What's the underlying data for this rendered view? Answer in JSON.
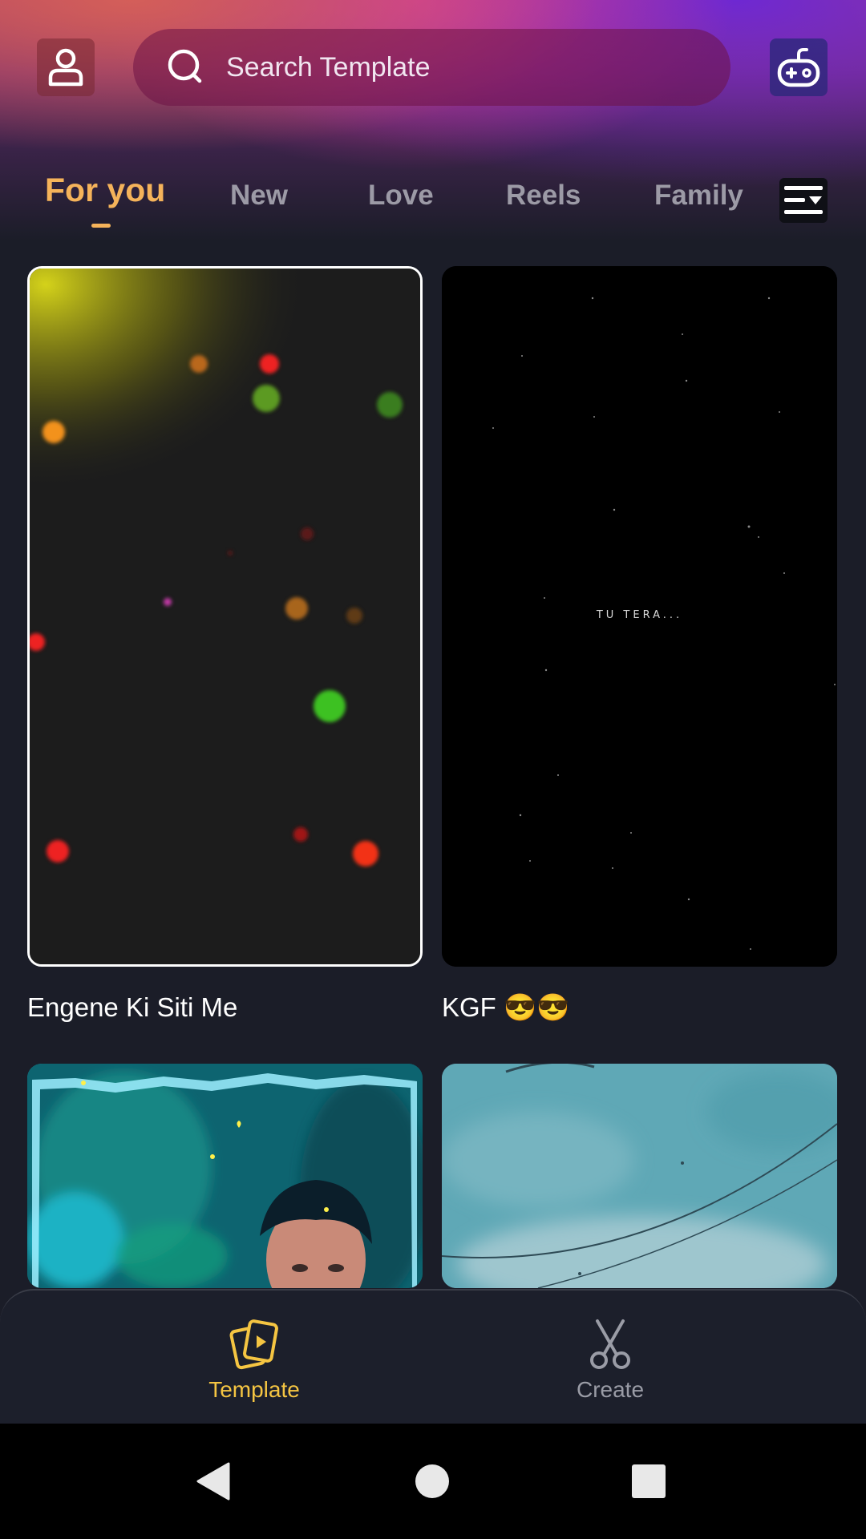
{
  "header": {
    "search_placeholder": "Search Template"
  },
  "tabs": [
    {
      "label": "For you",
      "active": true
    },
    {
      "label": "New",
      "active": false
    },
    {
      "label": "Love",
      "active": false
    },
    {
      "label": "Reels",
      "active": false
    },
    {
      "label": "Family",
      "active": false
    }
  ],
  "templates": [
    {
      "title": "Engene Ki Siti Me"
    },
    {
      "title": "KGF 😎😎",
      "preview_text": "TU TERA..."
    },
    {
      "title": ""
    },
    {
      "title": ""
    }
  ],
  "bottom_nav": [
    {
      "label": "Template",
      "active": true,
      "icon": "template-cards-icon"
    },
    {
      "label": "Create",
      "active": false,
      "icon": "scissors-icon"
    }
  ],
  "colors": {
    "accent": "#f5b35a",
    "inactive_tab": "#9c9aa6",
    "background": "#1b1d28",
    "nav_inactive": "#9a9ca6"
  }
}
